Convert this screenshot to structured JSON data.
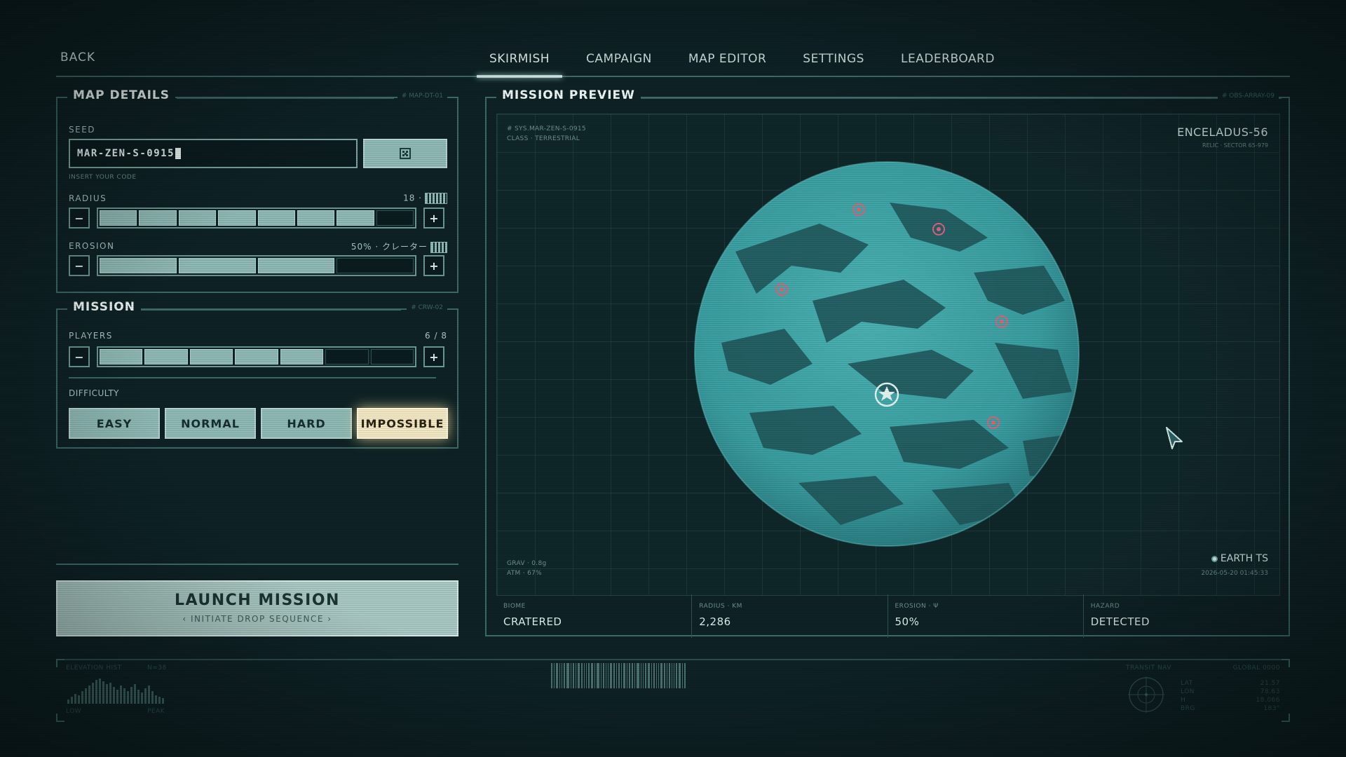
{
  "nav": {
    "back": "BACK",
    "tabs": [
      {
        "label": "SKIRMISH",
        "active": true
      },
      {
        "label": "CAMPAIGN",
        "active": false
      },
      {
        "label": "MAP EDITOR",
        "active": false
      },
      {
        "label": "SETTINGS",
        "active": false
      },
      {
        "label": "LEADERBOARD",
        "active": false
      }
    ]
  },
  "map_details": {
    "title": "MAP DETAILS",
    "code": "# MAP-DT-01",
    "seed_label": "SEED",
    "seed_value": "MAR-ZEN-S-0915",
    "seed_hint": "INSERT YOUR CODE",
    "radius_label": "RADIUS",
    "radius_value": "18 ·",
    "radius_filled": 7,
    "radius_total": 8,
    "erosion_label": "EROSION",
    "erosion_value": "50% · クレーター",
    "erosion_filled": 3,
    "erosion_total": 4,
    "minus": "−",
    "plus": "+"
  },
  "mission": {
    "title": "MISSION",
    "code": "# CRW-02",
    "players_label": "PLAYERS",
    "players_value": "6 / 8",
    "players_filled": 5,
    "players_total": 7,
    "difficulty_label": "DIFFICULTY",
    "difficulties": [
      "EASY",
      "NORMAL",
      "HARD",
      "IMPOSSIBLE"
    ],
    "selected_difficulty": "IMPOSSIBLE"
  },
  "launch": {
    "title": "LAUNCH MISSION",
    "subtitle": "INITIATE DROP SEQUENCE"
  },
  "preview": {
    "title": "MISSION PREVIEW",
    "code": "# OBS-ARRAY-09",
    "sys_line": "# SYS.MAR-ZEN-S-0915",
    "class_line": "CLASS · TERRESTRIAL",
    "planet_name": "ENCELADUS-56",
    "planet_sub": "RELIC · SECTOR 65-979",
    "grav": "GRAV · 0.8g",
    "atm": "ATM · 67%",
    "earth_label": "EARTH TS",
    "earth_time": "2026-05-20 01:45:33",
    "stats": [
      {
        "label": "BIOME",
        "value": "CRATERED"
      },
      {
        "label": "RADIUS · KM",
        "value": "2,286"
      },
      {
        "label": "EROSION · Ψ",
        "value": "50%"
      },
      {
        "label": "HAZARD",
        "value": "DETECTED"
      }
    ]
  },
  "footer": {
    "hist_label": "ELEVATION HIST",
    "hist_n": "N=38",
    "hist_low": "LOW",
    "hist_peak": "PEAK",
    "transit": "TRANSIT NAV",
    "global": "GLOBAL 0000",
    "coords": [
      "21.57",
      "78.63",
      "18.066",
      "183°"
    ],
    "coord_labels": [
      "LAT",
      "LON",
      "H",
      "BRG"
    ]
  },
  "colors": {
    "background": "#0e2225",
    "accent": "#8fb9b4",
    "panel_border": "#3e6a68",
    "selected": "#f3e8c4",
    "marker": "#e0607a",
    "planet": "#3fa3a6"
  }
}
